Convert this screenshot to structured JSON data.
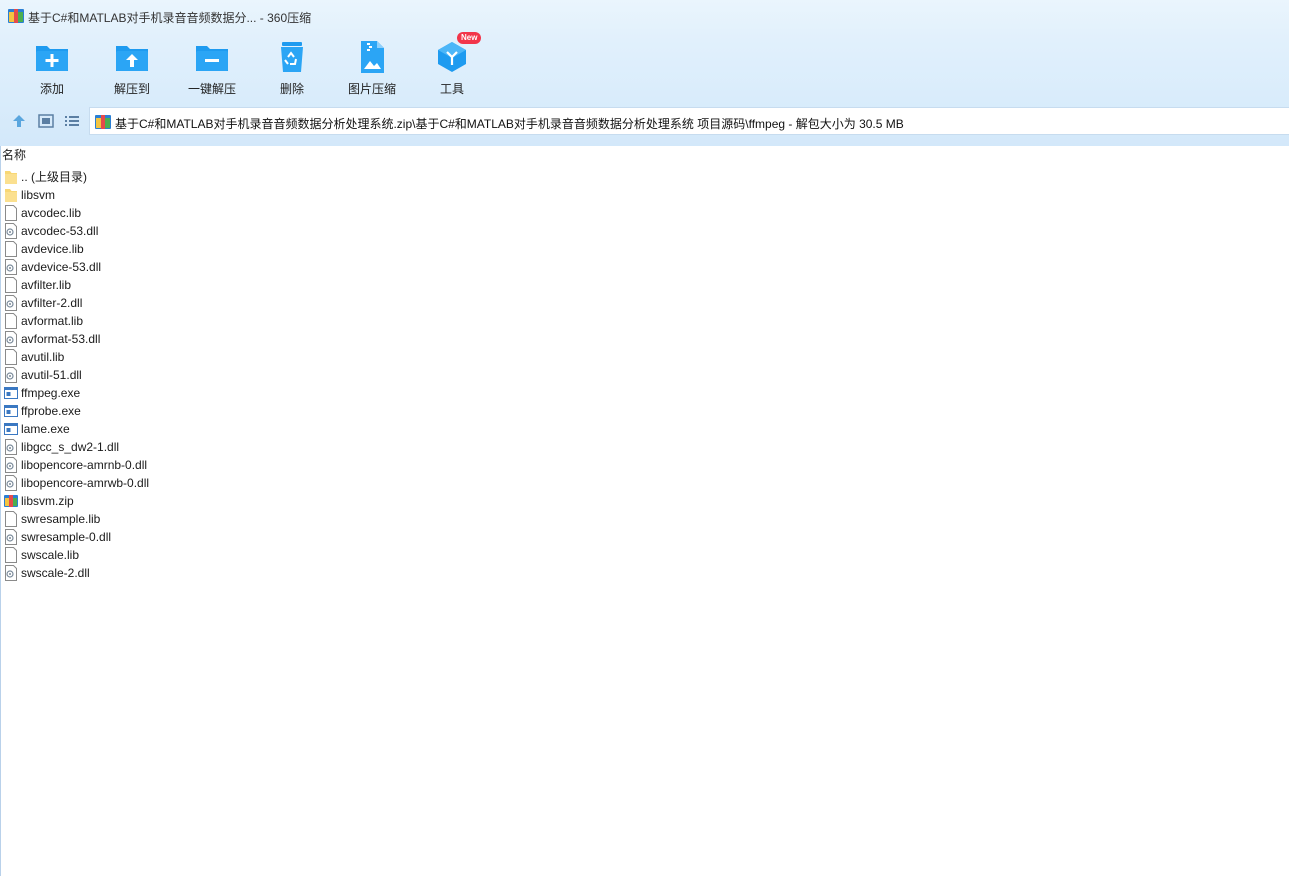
{
  "window": {
    "title": "基于C#和MATLAB对手机录音音频数据分... - 360压缩"
  },
  "toolbar": {
    "items": [
      {
        "label": "添加",
        "icon": "add-folder-icon"
      },
      {
        "label": "解压到",
        "icon": "extract-to-icon"
      },
      {
        "label": "一键解压",
        "icon": "one-click-extract-icon"
      },
      {
        "label": "删除",
        "icon": "recycle-bin-icon"
      },
      {
        "label": "图片压缩",
        "icon": "image-compress-icon"
      },
      {
        "label": "工具",
        "icon": "tools-cube-icon",
        "badge": "New"
      }
    ]
  },
  "address": {
    "path": "基于C#和MATLAB对手机录音音频数据分析处理系统.zip\\基于C#和MATLAB对手机录音音频数据分析处理系统 项目源码\\ffmpeg - 解包大小为 30.5 MB"
  },
  "list": {
    "column_name": "名称",
    "files": [
      {
        "name": ".. (上级目录)",
        "type": "folder"
      },
      {
        "name": "libsvm",
        "type": "folder"
      },
      {
        "name": "avcodec.lib",
        "type": "file"
      },
      {
        "name": "avcodec-53.dll",
        "type": "dll"
      },
      {
        "name": "avdevice.lib",
        "type": "file"
      },
      {
        "name": "avdevice-53.dll",
        "type": "dll"
      },
      {
        "name": "avfilter.lib",
        "type": "file"
      },
      {
        "name": "avfilter-2.dll",
        "type": "dll"
      },
      {
        "name": "avformat.lib",
        "type": "file"
      },
      {
        "name": "avformat-53.dll",
        "type": "dll"
      },
      {
        "name": "avutil.lib",
        "type": "file"
      },
      {
        "name": "avutil-51.dll",
        "type": "dll"
      },
      {
        "name": "ffmpeg.exe",
        "type": "exe"
      },
      {
        "name": "ffprobe.exe",
        "type": "exe"
      },
      {
        "name": "lame.exe",
        "type": "exe"
      },
      {
        "name": "libgcc_s_dw2-1.dll",
        "type": "dll"
      },
      {
        "name": "libopencore-amrnb-0.dll",
        "type": "dll"
      },
      {
        "name": "libopencore-amrwb-0.dll",
        "type": "dll"
      },
      {
        "name": "libsvm.zip",
        "type": "zip"
      },
      {
        "name": "swresample.lib",
        "type": "file"
      },
      {
        "name": "swresample-0.dll",
        "type": "dll"
      },
      {
        "name": "swscale.lib",
        "type": "file"
      },
      {
        "name": "swscale-2.dll",
        "type": "dll"
      }
    ]
  },
  "colors": {
    "accent": "#1e9bf0",
    "toolbar_bg": "#dcedfb",
    "folder": "#f8d775",
    "badge": "#f2354a"
  }
}
